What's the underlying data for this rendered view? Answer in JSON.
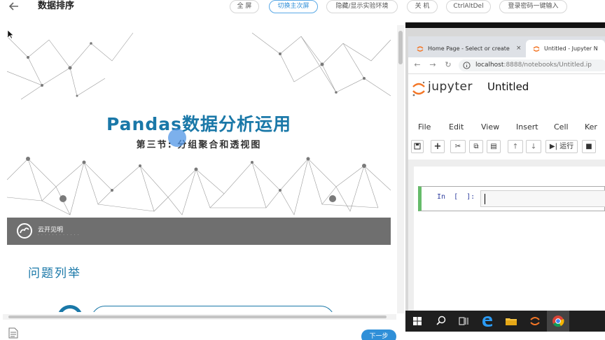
{
  "header": {
    "title": "数据排序",
    "buttons": [
      {
        "label": "全 屏"
      },
      {
        "label": "切换主次屏"
      },
      {
        "label": "隐藏/显示实验环境"
      },
      {
        "label": "关 机"
      },
      {
        "label": "CtrlAltDel"
      },
      {
        "label": "登录密码一键输入"
      }
    ]
  },
  "slide": {
    "title": "Pandas数据分析运用",
    "subtitle": "第三节: 分组聚合和透视图",
    "brand_name": "云开见明",
    "brand_sub": "· · · · · · · · · · · ·",
    "section_heading": "问题列举",
    "colors": {
      "accent": "#1a78a8",
      "brand_bar": "#6f6f6f"
    }
  },
  "footer": {
    "next_label": "下一步"
  },
  "browser": {
    "tabs": [
      {
        "label": "Home Page - Select or create",
        "icon": "jupyter-favicon-icon"
      },
      {
        "label": "Untitled - Jupyter N",
        "icon": "jupyter-favicon-icon"
      }
    ],
    "url_host": "localhost",
    "url_rest": ":8888/notebooks/Untitled.ip"
  },
  "jupyter": {
    "brand": "jupyter",
    "notebook_title": "Untitled",
    "menu": [
      "File",
      "Edit",
      "View",
      "Insert",
      "Cell",
      "Ker"
    ],
    "run_label": "运行",
    "cell_prompt": "In  [  ]:"
  }
}
